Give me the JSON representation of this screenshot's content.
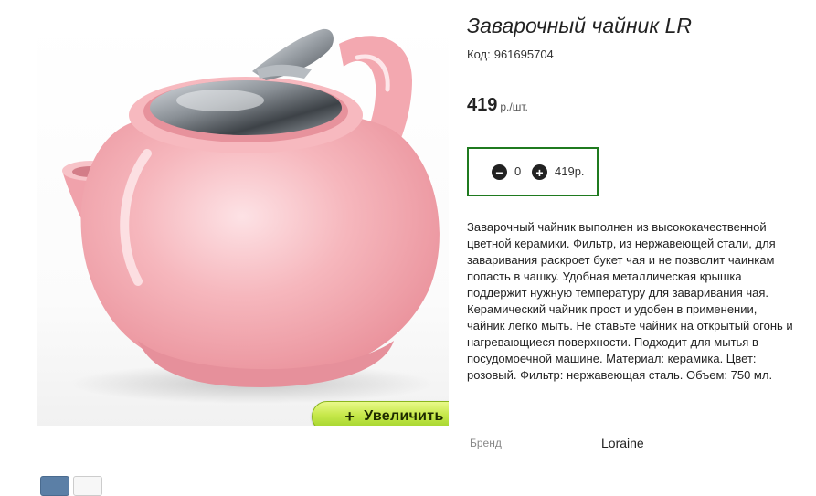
{
  "product": {
    "title": "Заварочный чайник LR",
    "code_label": "Код:",
    "code": "961695704",
    "price": "419",
    "price_unit": "р./шт.",
    "description": "Заварочный чайник выполнен из высококачественной цветной керамики. Фильтр, из нержавеющей стали, для заваривания раскроет букет чая и не позволит чаинкам попасть в чашку. Удобная металлическая крышка поддержит нужную температуру для заваривания чая. Керамический чайник прост и удобен в применении, чайник легко мыть. Не ставьте чайник на открытый огонь и нагревающиеся поверхности. Подходит для мытья в посудомоечной машине. Материал: керамика. Цвет: розовый. Фильтр: нержавеющая сталь. Объем: 750 мл.",
    "brand_label": "Бренд",
    "brand": "Loraine",
    "image_icon": "pink-teapot-image"
  },
  "quantity": {
    "value": "0",
    "total": "419р.",
    "minus_icon": "minus-circle-icon",
    "plus_icon": "plus-circle-icon",
    "minus_symbol": "−",
    "plus_symbol": "+"
  },
  "zoom": {
    "plus": "+",
    "label": "Увеличить"
  },
  "colors": {
    "accent_border": "#1f7a1f",
    "zoom_button": "#c6e84a",
    "teapot": "#f4a9b0"
  }
}
